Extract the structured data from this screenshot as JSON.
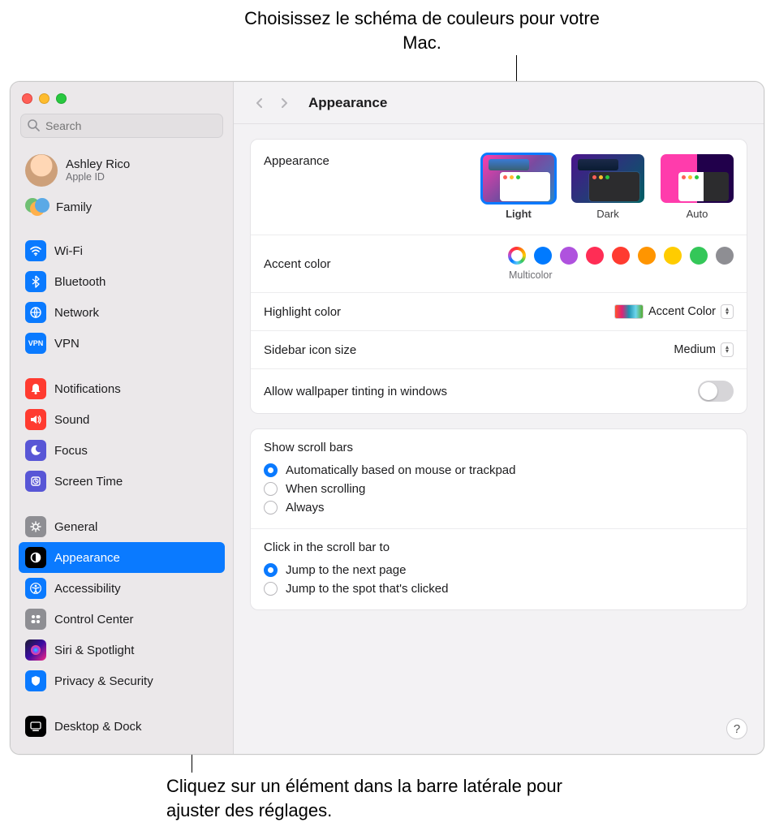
{
  "callouts": {
    "top": "Choisissez le schéma de couleurs pour votre Mac.",
    "bottom": "Cliquez sur un élément dans la barre latérale pour ajuster des réglages."
  },
  "search": {
    "placeholder": "Search"
  },
  "user": {
    "name": "Ashley Rico",
    "sub": "Apple ID"
  },
  "family": {
    "label": "Family"
  },
  "sidebar_groups": [
    [
      {
        "id": "wifi",
        "label": "Wi-Fi",
        "color": "#0a7aff"
      },
      {
        "id": "bluetooth",
        "label": "Bluetooth",
        "color": "#0a7aff"
      },
      {
        "id": "network",
        "label": "Network",
        "color": "#0a7aff"
      },
      {
        "id": "vpn",
        "label": "VPN",
        "color": "#0a7aff"
      }
    ],
    [
      {
        "id": "notifications",
        "label": "Notifications",
        "color": "#ff3b30"
      },
      {
        "id": "sound",
        "label": "Sound",
        "color": "#ff3b30"
      },
      {
        "id": "focus",
        "label": "Focus",
        "color": "#5856d6"
      },
      {
        "id": "screentime",
        "label": "Screen Time",
        "color": "#5856d6"
      }
    ],
    [
      {
        "id": "general",
        "label": "General",
        "color": "#8e8e93"
      },
      {
        "id": "appearance",
        "label": "Appearance",
        "color": "#000000",
        "selected": true
      },
      {
        "id": "accessibility",
        "label": "Accessibility",
        "color": "#0a7aff"
      },
      {
        "id": "controlcenter",
        "label": "Control Center",
        "color": "#8e8e93"
      },
      {
        "id": "siri",
        "label": "Siri & Spotlight",
        "color": "#g",
        "gradient": true
      },
      {
        "id": "privacy",
        "label": "Privacy & Security",
        "color": "#0a7aff"
      }
    ],
    [
      {
        "id": "desktop",
        "label": "Desktop & Dock",
        "color": "#000000"
      }
    ]
  ],
  "title": "Appearance",
  "appearance": {
    "label": "Appearance",
    "modes": [
      {
        "id": "light",
        "label": "Light",
        "selected": true
      },
      {
        "id": "dark",
        "label": "Dark"
      },
      {
        "id": "auto",
        "label": "Auto"
      }
    ],
    "accent_label": "Accent color",
    "accent_selected_label": "Multicolor",
    "accent_colors": [
      "multicolor",
      "#007aff",
      "#af52de",
      "#ff2d55",
      "#ff3b30",
      "#ff9500",
      "#ffcc00",
      "#34c759",
      "#8e8e93"
    ],
    "highlight_label": "Highlight color",
    "highlight_value": "Accent Color",
    "sidebar_size_label": "Sidebar icon size",
    "sidebar_size_value": "Medium",
    "tinting_label": "Allow wallpaper tinting in windows",
    "scroll_title": "Show scroll bars",
    "scroll_options": [
      {
        "label": "Automatically based on mouse or trackpad",
        "checked": true
      },
      {
        "label": "When scrolling"
      },
      {
        "label": "Always"
      }
    ],
    "click_title": "Click in the scroll bar to",
    "click_options": [
      {
        "label": "Jump to the next page",
        "checked": true
      },
      {
        "label": "Jump to the spot that's clicked"
      }
    ]
  },
  "help": "?"
}
